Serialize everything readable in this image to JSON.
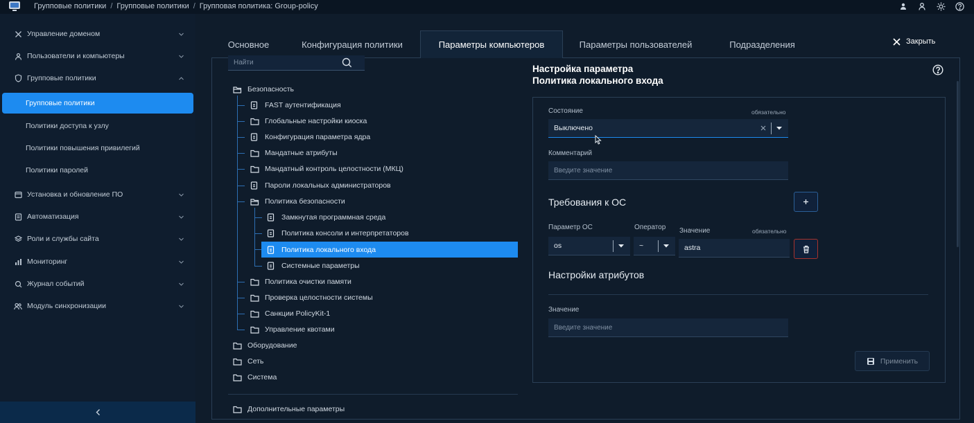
{
  "breadcrumb": [
    "Групповые политики",
    "Групповые политики",
    "Групповая политика: Group-policy"
  ],
  "breadcrumb_sep": "/",
  "top_icons": [
    "user-group-icon",
    "user-icon",
    "sun-icon",
    "help-icon"
  ],
  "sidebar": {
    "items": [
      {
        "label": "Управление доменом",
        "icon": "tools-icon",
        "expanded": false
      },
      {
        "label": "Пользователи и компьютеры",
        "icon": "user-icon",
        "expanded": false
      },
      {
        "label": "Групповые политики",
        "icon": "shield-icon",
        "expanded": true
      },
      {
        "label": "Установка и обновление ПО",
        "icon": "install-icon",
        "expanded": false
      },
      {
        "label": "Автоматизация",
        "icon": "automation-icon",
        "expanded": false
      },
      {
        "label": "Роли и службы сайта",
        "icon": "roles-icon",
        "expanded": false
      },
      {
        "label": "Мониторинг",
        "icon": "chart-icon",
        "expanded": false
      },
      {
        "label": "Журнал событий",
        "icon": "search-log-icon",
        "expanded": false
      },
      {
        "label": "Модуль синхронизации",
        "icon": "sync-users-icon",
        "expanded": false
      }
    ],
    "subitems": [
      {
        "label": "Групповые политики",
        "active": true
      },
      {
        "label": "Политики доступа к узлу",
        "active": false
      },
      {
        "label": "Политики повышения привилегий",
        "active": false
      },
      {
        "label": "Политики паролей",
        "active": false
      }
    ],
    "collapse_icon": "chevron-left-icon"
  },
  "tabs": [
    {
      "label": "Основное",
      "active": false
    },
    {
      "label": "Конфигурация политики",
      "active": false
    },
    {
      "label": "Параметры компьютеров",
      "active": true
    },
    {
      "label": "Параметры пользователей",
      "active": false
    },
    {
      "label": "Подразделения",
      "active": false
    }
  ],
  "close_label": "Закрыть",
  "search": {
    "placeholder": "Найти"
  },
  "tree": [
    {
      "label": "Безопасность",
      "icon": "folder-open-icon"
    },
    {
      "label": "FAST аутентификация",
      "icon": "file-icon"
    },
    {
      "label": "Глобальные настройки киоска",
      "icon": "folder-icon"
    },
    {
      "label": "Конфигурация параметра ядра",
      "icon": "file-icon"
    },
    {
      "label": "Мандатные атрибуты",
      "icon": "folder-icon"
    },
    {
      "label": "Мандатный контроль целостности (МКЦ)",
      "icon": "folder-icon"
    },
    {
      "label": "Пароли локальных администраторов",
      "icon": "file-icon"
    },
    {
      "label": "Политика безопасности",
      "icon": "folder-open-icon"
    },
    {
      "label": "Замкнутая программная среда",
      "icon": "file-icon"
    },
    {
      "label": "Политика консоли и интерпретаторов",
      "icon": "file-icon"
    },
    {
      "label": "Политика локального входа",
      "icon": "file-icon",
      "selected": true
    },
    {
      "label": "Системные параметры",
      "icon": "file-icon"
    },
    {
      "label": "Политика очистки памяти",
      "icon": "folder-icon"
    },
    {
      "label": "Проверка целостности системы",
      "icon": "folder-icon"
    },
    {
      "label": "Санкции PolicyKit-1",
      "icon": "folder-icon"
    },
    {
      "label": "Управление квотами",
      "icon": "folder-icon"
    },
    {
      "label": "Оборудование",
      "icon": "folder-icon"
    },
    {
      "label": "Сеть",
      "icon": "folder-icon"
    },
    {
      "label": "Система",
      "icon": "folder-icon"
    },
    {
      "label": "Дополнительные параметры",
      "icon": "folder-icon"
    }
  ],
  "panel": {
    "title_line1": "Настройка параметра",
    "title_line2": "Политика локального входа",
    "state_label": "Состояние",
    "required": "обязательно",
    "state_value": "Выключено",
    "comment_label": "Комментарий",
    "comment_placeholder": "Введите значение",
    "os_section": "Требования к ОС",
    "os_param_label": "Параметр ОС",
    "operator_label": "Оператор",
    "value_label": "Значение",
    "os_param_value": "os",
    "operator_value": "~",
    "os_value": "astra",
    "attr_section": "Настройки атрибутов",
    "attr_value_label": "Значение",
    "attr_value_placeholder": "Введите значение",
    "apply_label": "Применить"
  },
  "colors": {
    "accent": "#1d8bf0",
    "background": "#0f1c2b",
    "danger": "#a8322c"
  }
}
